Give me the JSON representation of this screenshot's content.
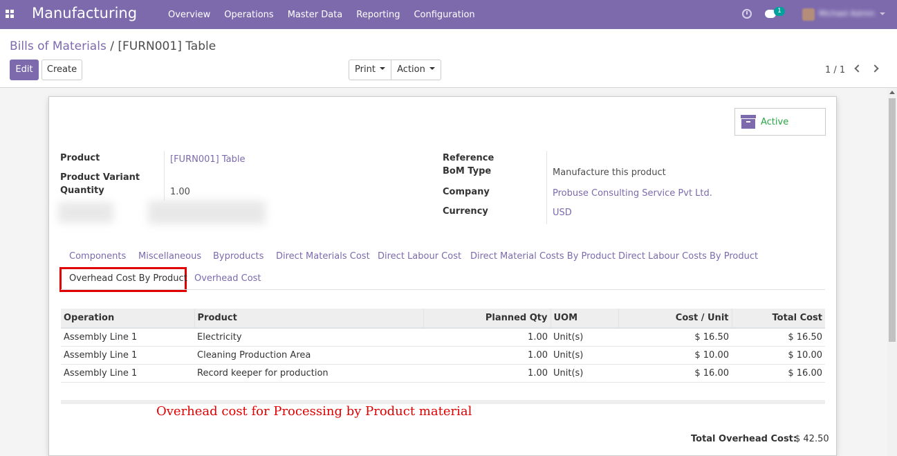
{
  "navbar": {
    "app_name": "Manufacturing",
    "menu": [
      "Overview",
      "Operations",
      "Master Data",
      "Reporting",
      "Configuration"
    ],
    "chat_count": "1",
    "user_name": "Michael Admin"
  },
  "breadcrumb": {
    "parent": "Bills of Materials",
    "separator": "/",
    "current": "[FURN001] Table"
  },
  "buttons": {
    "edit": "Edit",
    "create": "Create",
    "print": "Print",
    "action": "Action"
  },
  "pager": "1 / 1",
  "status": {
    "label": "Active"
  },
  "fields": {
    "product_label": "Product",
    "product_value": "[FURN001] Table",
    "variant_label": "Product Variant",
    "quantity_label": "Quantity",
    "quantity_value": "1.00",
    "reference_label": "Reference",
    "bom_type_label": "BoM Type",
    "bom_type_value": "Manufacture this product",
    "company_label": "Company",
    "company_value": "Probuse Consulting Service Pvt Ltd.",
    "currency_label": "Currency",
    "currency_value": "USD"
  },
  "tabs": [
    "Components",
    "Miscellaneous",
    "Byproducts",
    "Direct Materials Cost",
    "Direct Labour Cost",
    "Direct Material Costs By Product",
    "Direct Labour Costs By Product",
    "Overhead Cost By Product",
    "Overhead Cost"
  ],
  "table": {
    "headers": [
      "Operation",
      "Product",
      "Planned Qty",
      "UOM",
      "Cost / Unit",
      "Total Cost"
    ],
    "rows": [
      [
        "Assembly Line 1",
        "Electricity",
        "1.00",
        "Unit(s)",
        "$ 16.50",
        "$ 16.50"
      ],
      [
        "Assembly Line 1",
        "Cleaning Production Area",
        "1.00",
        "Unit(s)",
        "$ 10.00",
        "$ 10.00"
      ],
      [
        "Assembly Line 1",
        "Record keeper for production",
        "1.00",
        "Unit(s)",
        "$ 16.00",
        "$ 16.00"
      ]
    ]
  },
  "annotation": "Overhead cost for Processing by Product material",
  "total": {
    "label": "Total Overhead Cost:",
    "value": "$ 42.50"
  },
  "colors": {
    "brand": "#7c6aad",
    "active_green": "#28a745",
    "highlight_red": "#e00000"
  }
}
